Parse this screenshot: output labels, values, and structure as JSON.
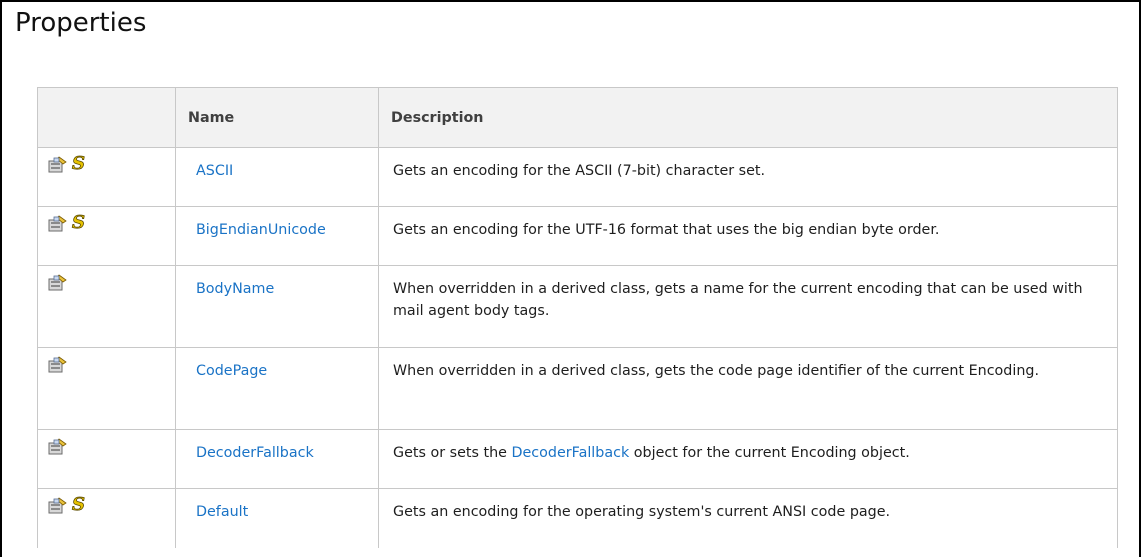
{
  "title": "Properties",
  "columns": {
    "icon": "",
    "name": "Name",
    "description": "Description"
  },
  "rows": [
    {
      "static": true,
      "name": "ASCII",
      "description": "Gets an encoding for the ASCII (7-bit) character set."
    },
    {
      "static": true,
      "name": "BigEndianUnicode",
      "description": "Gets an encoding for the UTF-16 format that uses the big endian byte order."
    },
    {
      "static": false,
      "name": "BodyName",
      "description": "When overridden in a derived class, gets a name for the current encoding that can be used with mail agent body tags."
    },
    {
      "static": false,
      "name": "CodePage",
      "description": "When overridden in a derived class, gets the code page identifier of the current Encoding."
    },
    {
      "static": false,
      "name": "DecoderFallback",
      "description_pre": "Gets or sets the ",
      "description_link": "DecoderFallback",
      "description_post": " object for the current Encoding object."
    },
    {
      "static": true,
      "name": "Default",
      "description": "Gets an encoding for the operating system's current ANSI code page."
    }
  ],
  "icons": {
    "property": "property-icon",
    "static": "static-icon",
    "static_glyph": "S"
  },
  "colors": {
    "link": "#1a73c6",
    "header_bg": "#f2f2f2",
    "border": "#c8c8c8",
    "static_icon": "#e6c200"
  }
}
